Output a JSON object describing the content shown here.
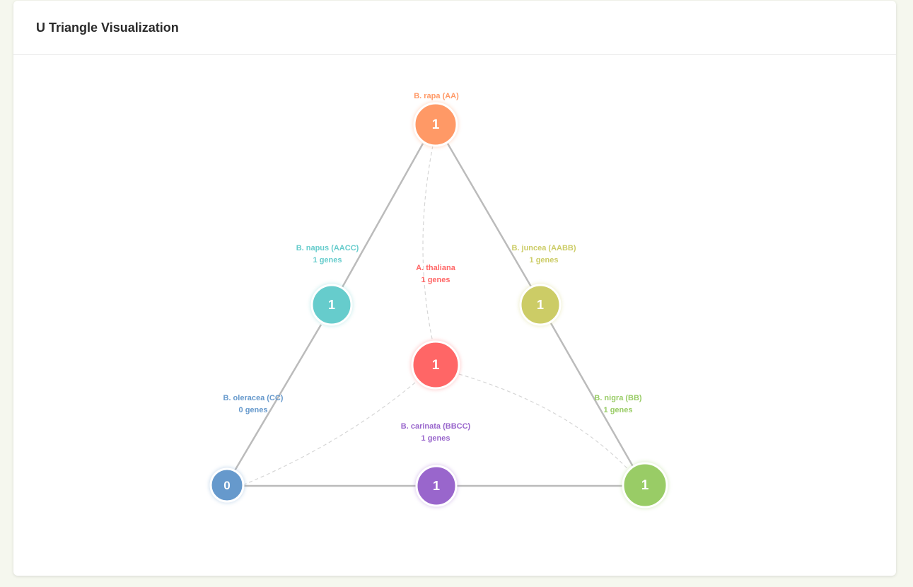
{
  "header": {
    "title": "U Triangle Visualization"
  },
  "nodes": [
    {
      "id": "rapa",
      "name": "B. rapa (AA)",
      "value": "1",
      "color": "#ff9966"
    },
    {
      "id": "napus",
      "name": "B. napus (AACC)",
      "count_text": "1 genes",
      "value": "1",
      "color": "#66cccc"
    },
    {
      "id": "juncea",
      "name": "B. juncea (AABB)",
      "count_text": "1 genes",
      "value": "1",
      "color": "#cccc66"
    },
    {
      "id": "thaliana",
      "name": "A. thaliana",
      "count_text": "1 genes",
      "value": "1",
      "color": "#ff6666"
    },
    {
      "id": "oleracea",
      "name": "B. oleracea (CC)",
      "count_text": "0 genes",
      "value": "0",
      "color": "#6699cc"
    },
    {
      "id": "carinata",
      "name": "B. carinata (BBCC)",
      "count_text": "1 genes",
      "value": "1",
      "color": "#9966cc"
    },
    {
      "id": "nigra",
      "name": "B. nigra (BB)",
      "count_text": "1 genes",
      "value": "1",
      "color": "#99cc66"
    }
  ]
}
